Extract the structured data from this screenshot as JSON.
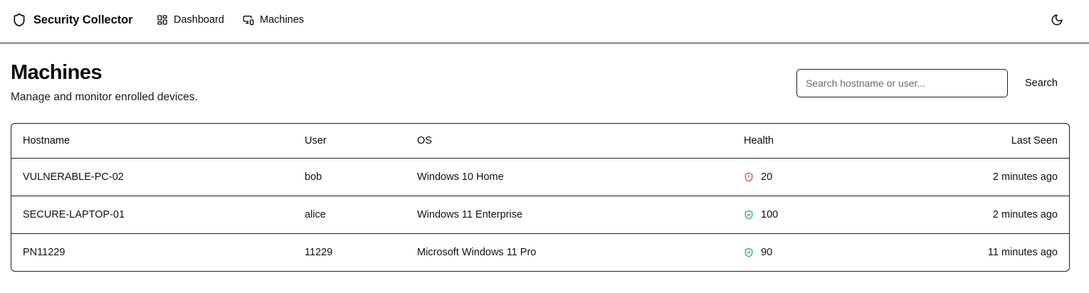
{
  "brand": {
    "title": "Security Collector",
    "icon": "shield-icon"
  },
  "nav": {
    "items": [
      {
        "label": "Dashboard",
        "icon": "dashboard-grid-icon"
      },
      {
        "label": "Machines",
        "icon": "devices-icon"
      }
    ]
  },
  "theme_toggle": {
    "icon": "moon-icon"
  },
  "page": {
    "title": "Machines",
    "subtitle": "Manage and monitor enrolled devices."
  },
  "search": {
    "placeholder": "Search hostname or user...",
    "value": "",
    "button_label": "Search"
  },
  "table": {
    "columns": [
      "Hostname",
      "User",
      "OS",
      "Health",
      "Last Seen"
    ],
    "rows": [
      {
        "hostname": "VULNERABLE-PC-02",
        "user": "bob",
        "os": "Windows 10 Home",
        "health": "20",
        "health_status": "critical",
        "last_seen": "2 minutes ago"
      },
      {
        "hostname": "SECURE-LAPTOP-01",
        "user": "alice",
        "os": "Windows 11 Enterprise",
        "health": "100",
        "health_status": "healthy",
        "last_seen": "2 minutes ago"
      },
      {
        "hostname": "PN11229",
        "user": "11229",
        "os": "Microsoft Windows 11 Pro",
        "health": "90",
        "health_status": "healthy",
        "last_seen": "11 minutes ago"
      }
    ]
  },
  "colors": {
    "critical": "#e5484d",
    "healthy": "#22b356",
    "border": "#1f1f1f"
  }
}
